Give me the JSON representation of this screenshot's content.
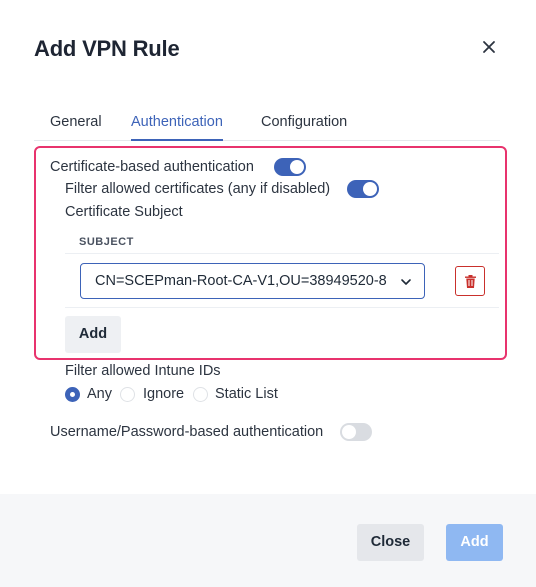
{
  "dialog": {
    "title": "Add VPN Rule"
  },
  "tabs": [
    {
      "label": "General",
      "active": false
    },
    {
      "label": "Authentication",
      "active": true
    },
    {
      "label": "Configuration",
      "active": false
    }
  ],
  "certificate_auth": {
    "label": "Certificate-based authentication",
    "enabled": true,
    "filter_label": "Filter allowed certificates (any if disabled)",
    "filter_enabled": true,
    "subject_section_label": "Certificate Subject",
    "table_header": "SUBJECT",
    "subject_value": "CN=SCEPman-Root-CA-V1,OU=38949520-8",
    "add_label": "Add"
  },
  "intune": {
    "label": "Filter allowed Intune IDs",
    "options": [
      {
        "label": "Any",
        "checked": true
      },
      {
        "label": "Ignore",
        "checked": false
      },
      {
        "label": "Static List",
        "checked": false
      }
    ]
  },
  "password_auth": {
    "label": "Username/Password-based authentication",
    "enabled": false
  },
  "footer": {
    "close_label": "Close",
    "add_label": "Add"
  },
  "colors": {
    "accent": "#3d63b8",
    "highlight": "#e8336d",
    "danger": "#c9302c",
    "add_button_disabled": "#8fb8f2"
  }
}
